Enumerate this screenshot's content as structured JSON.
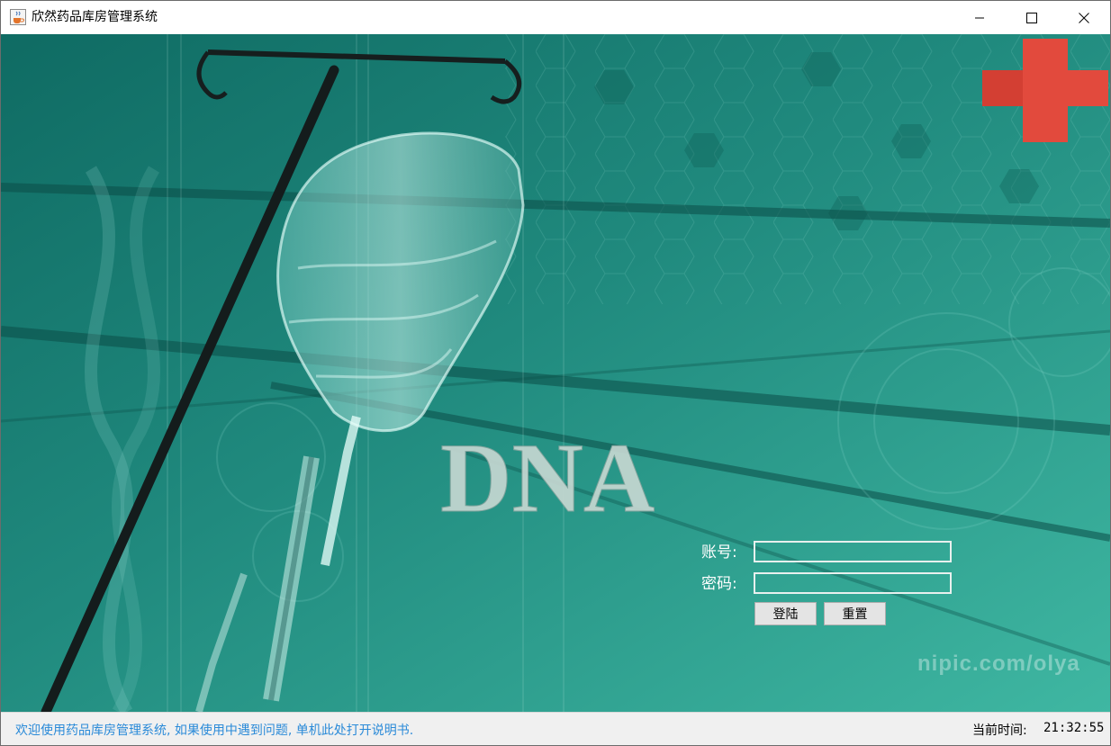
{
  "window": {
    "title": "欣然药品库房管理系统",
    "app_icon": "java-cup-icon",
    "controls": [
      "minimize-icon",
      "maximize-icon",
      "close-icon"
    ]
  },
  "banner": {
    "dna_text": "DNA",
    "watermark": "nipic.com/olya",
    "colors": {
      "background": "#1f8478",
      "cross": "#e2483c"
    }
  },
  "login": {
    "account_label": "账号:",
    "account_value": "",
    "password_label": "密码:",
    "password_value": "",
    "login_button": "登陆",
    "reset_button": "重置"
  },
  "statusbar": {
    "message": "欢迎使用药品库房管理系统, 如果使用中遇到问题, 单机此处打开说明书.",
    "time_label": "当前时间:",
    "time_value": "21:32:55"
  }
}
